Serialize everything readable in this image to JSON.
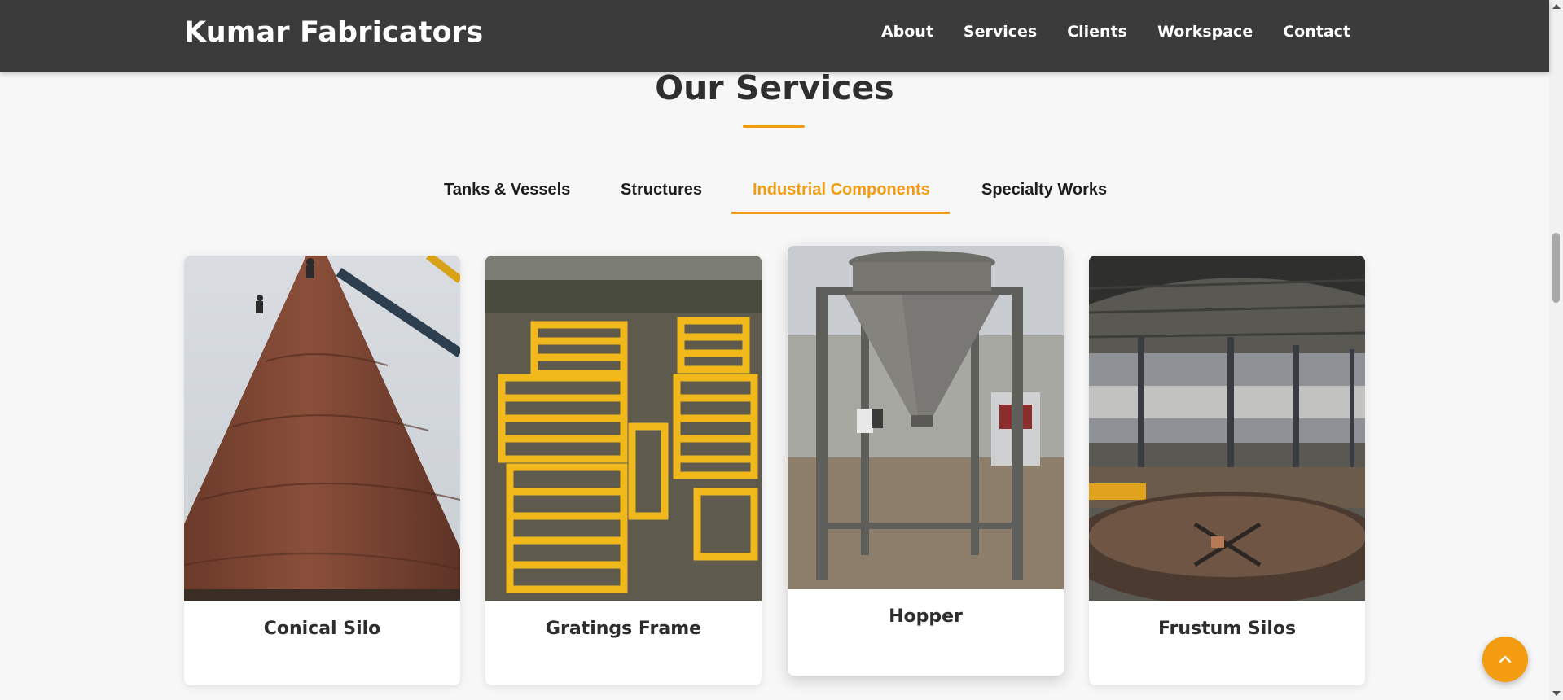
{
  "brand": {
    "name": "Kumar Fabricators"
  },
  "nav": {
    "items": [
      "About",
      "Services",
      "Clients",
      "Workspace",
      "Contact"
    ]
  },
  "section": {
    "title": "Our Services"
  },
  "tabs": {
    "items": [
      "Tanks & Vessels",
      "Structures",
      "Industrial Components",
      "Specialty Works"
    ],
    "active": "Industrial Components"
  },
  "cards": [
    {
      "title": "Conical Silo",
      "icon": "conical-silo-photo"
    },
    {
      "title": "Gratings Frame",
      "icon": "gratings-frame-photo"
    },
    {
      "title": "Hopper",
      "icon": "hopper-photo"
    },
    {
      "title": "Frustum Silos",
      "icon": "frustum-silos-photo"
    }
  ],
  "colors": {
    "accent": "#f39c12",
    "header_bg": "#3b3b3b",
    "page_bg": "#f7f7f7"
  },
  "controls": {
    "back_to_top_icon": "chevron-up-icon"
  }
}
